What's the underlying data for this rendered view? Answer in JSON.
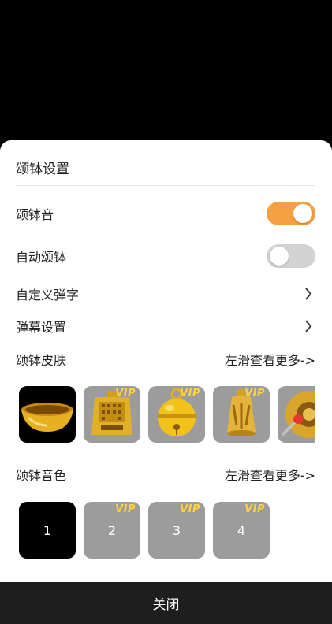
{
  "sheet": {
    "title": "颂钵设置",
    "rows": {
      "sound": {
        "label": "颂钵音",
        "toggle_on": true
      },
      "auto": {
        "label": "自动颂钵",
        "toggle_on": false
      },
      "custom_barrage": {
        "label": "自定义弹字"
      },
      "barrage_settings": {
        "label": "弹幕设置"
      }
    },
    "skins": {
      "label": "颂钵皮肤",
      "more": "左滑查看更多->",
      "items": [
        {
          "icon": "golden-bowl-icon",
          "vip": ""
        },
        {
          "icon": "bronze-bell-icon",
          "vip": "VIP"
        },
        {
          "icon": "jingle-bell-icon",
          "vip": "VIP"
        },
        {
          "icon": "temple-bell-icon",
          "vip": "VIP"
        },
        {
          "icon": "gong-icon",
          "vip": ""
        }
      ]
    },
    "tones": {
      "label": "颂钵音色",
      "more": "左滑查看更多->",
      "items": [
        {
          "number": "1",
          "vip": ""
        },
        {
          "number": "2",
          "vip": "VIP"
        },
        {
          "number": "3",
          "vip": "VIP"
        },
        {
          "number": "4",
          "vip": "VIP"
        }
      ]
    },
    "close_label": "关闭"
  },
  "colors": {
    "accent": "#F5A043",
    "toggle_off": "#D3D3D3",
    "tile_gray": "#9C9C9C",
    "vip_gold": "#FFD23A",
    "close_bar": "#1E1E1E"
  }
}
